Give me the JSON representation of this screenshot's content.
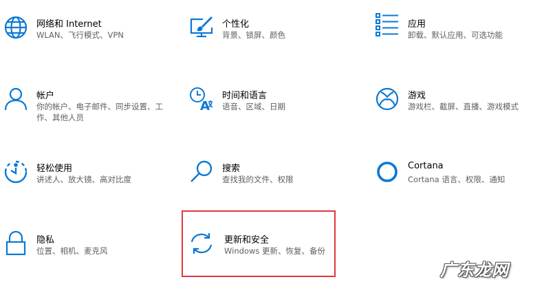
{
  "accent_color": "#0a78d4",
  "highlight_color": "#e0353d",
  "settings": [
    {
      "name": "network",
      "icon": "globe-icon",
      "title": "网络和 Internet",
      "desc": "WLAN、飞行模式、VPN"
    },
    {
      "name": "personalization",
      "icon": "personalization-brush-icon",
      "title": "个性化",
      "desc": "背景、锁屏、颜色"
    },
    {
      "name": "apps",
      "icon": "apps-list-icon",
      "title": "应用",
      "desc": "卸载、默认应用、可选功能"
    },
    {
      "name": "accounts",
      "icon": "person-icon",
      "title": "帐户",
      "desc": "你的帐户、电子邮件、同步设置、工作、其他人员"
    },
    {
      "name": "time-language",
      "icon": "time-language-icon",
      "title": "时间和语言",
      "desc": "语音、区域、日期"
    },
    {
      "name": "gaming",
      "icon": "xbox-icon",
      "title": "游戏",
      "desc": "游戏栏、截屏、直播、游戏模式"
    },
    {
      "name": "ease-of-access",
      "icon": "ease-of-access-icon",
      "title": "轻松使用",
      "desc": "讲述人、放大镜、高对比度"
    },
    {
      "name": "search",
      "icon": "search-magnifier-icon",
      "title": "搜索",
      "desc": "查找我的文件、权限"
    },
    {
      "name": "cortana",
      "icon": "cortana-ring-icon",
      "title": "Cortana",
      "desc": "Cortana 语言、权限、通知"
    },
    {
      "name": "privacy",
      "icon": "lock-icon",
      "title": "隐私",
      "desc": "位置、相机、麦克风"
    },
    {
      "name": "update-security",
      "icon": "update-sync-icon",
      "title": "更新和安全",
      "desc": "Windows 更新、恢复、备份"
    }
  ],
  "watermark": "广东龙网"
}
